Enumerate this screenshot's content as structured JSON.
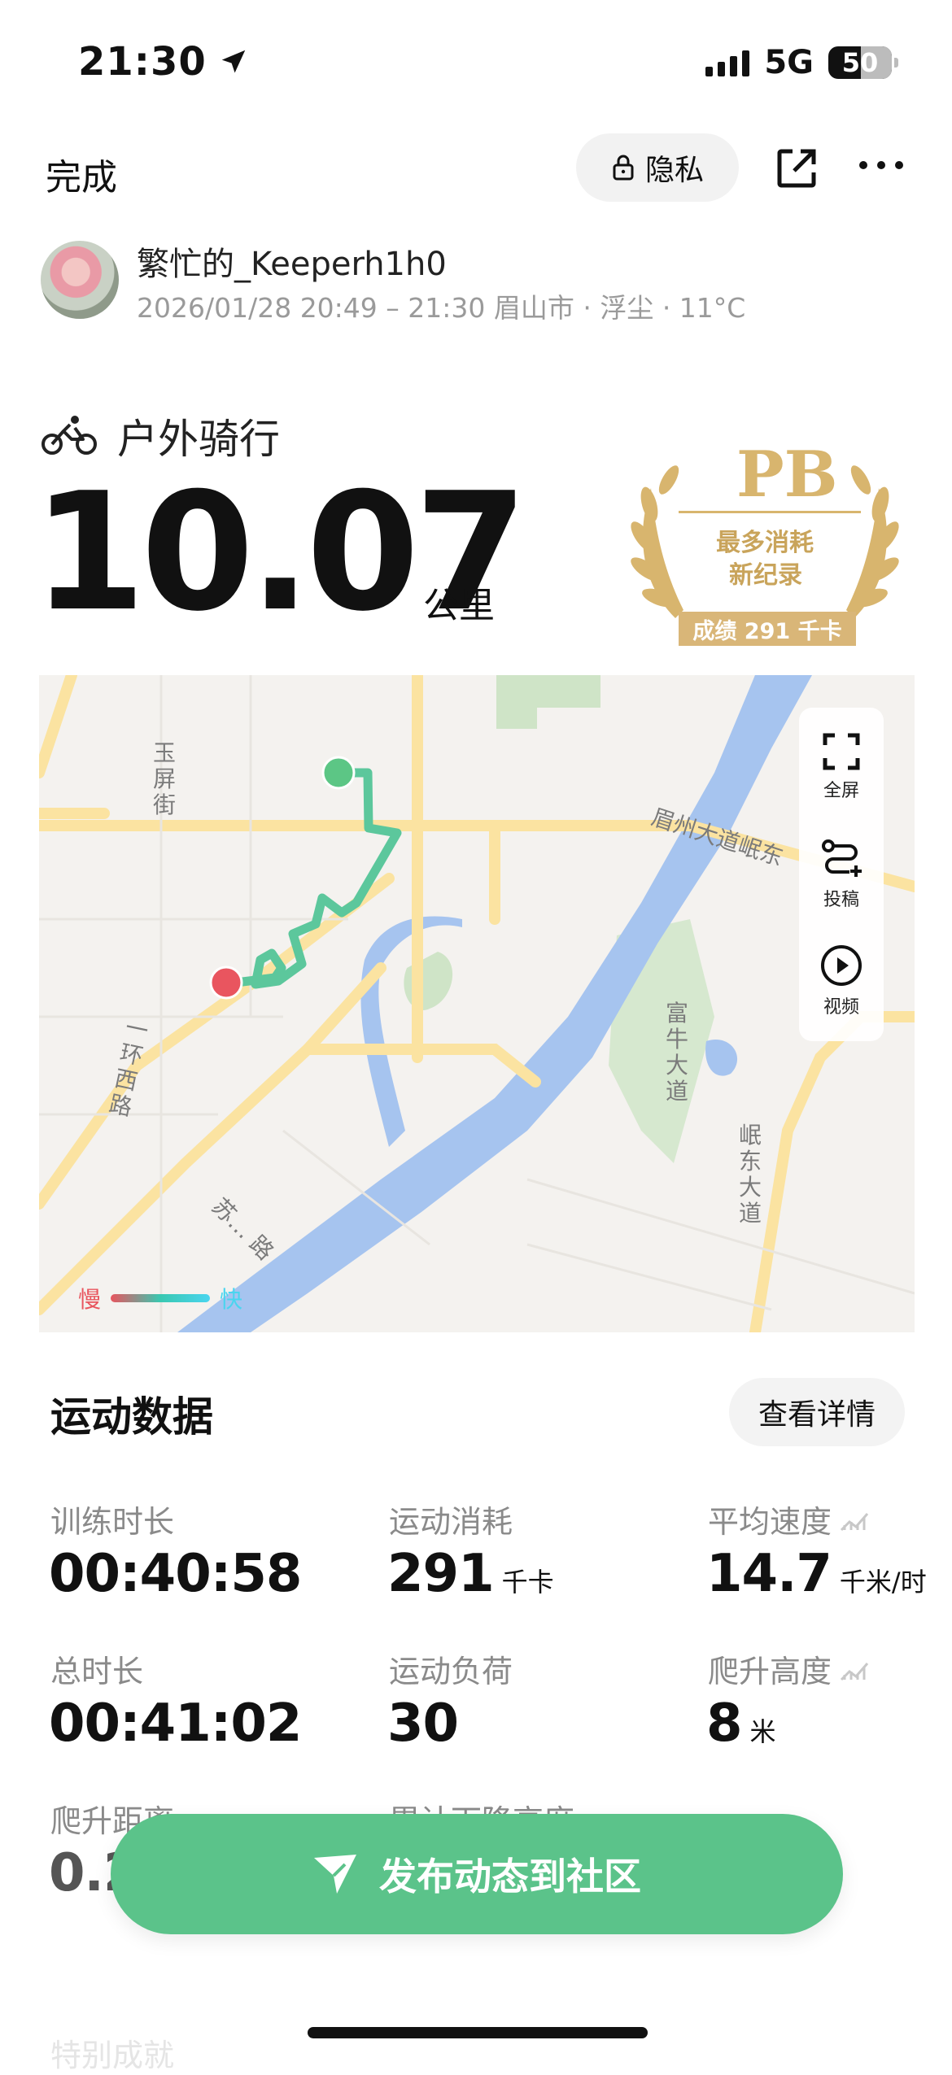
{
  "status_bar": {
    "time": "21:30",
    "network": "5G",
    "battery": "50"
  },
  "topbar": {
    "done_label": "完成",
    "privacy_label": "隐私"
  },
  "user": {
    "name": "繁忙的_Keeperh1h0",
    "meta": "2026/01/28 20:49 – 21:30 眉山市 · 浮尘 · 11°C"
  },
  "activity": {
    "type": "户外骑行",
    "distance": "10.07",
    "distance_unit": "公里"
  },
  "pb_badge": {
    "title": "PB",
    "line1": "最多消耗",
    "line2": "新纪录",
    "score": "成绩 291 千卡"
  },
  "map": {
    "controls": {
      "fullscreen": "全屏",
      "cast": "投稿",
      "video": "视频"
    },
    "labels": {
      "yuping_street": "玉屏街",
      "yihuan_west": "一环西路",
      "meizhou_avenue": "眉州大道岷东",
      "fu_niu_avenue": "富牛大道",
      "mindong_avenue": "岷东大道",
      "su_street": "苏… 路"
    },
    "legend": {
      "slow": "慢",
      "fast": "快"
    },
    "colors": {
      "route": "#5cc79c",
      "start": "#5cc685",
      "end": "#e9555f",
      "river": "#a6c4ef",
      "road": "#fbe3a1"
    }
  },
  "stats": {
    "section_title": "运动数据",
    "detail_button": "查看详情",
    "items": [
      {
        "label": "训练时长",
        "value": "00:40:58",
        "unit": ""
      },
      {
        "label": "运动消耗",
        "value": "291",
        "unit": "千卡"
      },
      {
        "label": "平均速度",
        "value": "14.7",
        "unit": "千米/时"
      },
      {
        "label": "总时长",
        "value": "00:41:02",
        "unit": ""
      },
      {
        "label": "运动负荷",
        "value": "30",
        "unit": ""
      },
      {
        "label": "爬升高度",
        "value": "8",
        "unit": "米"
      },
      {
        "label": "爬升距离",
        "value": "0.2",
        "unit": ""
      },
      {
        "label": "累计下降高度",
        "value": "",
        "unit": ""
      }
    ]
  },
  "post_button": {
    "label": "发布动态到社区"
  },
  "faded_section": "特别成就"
}
